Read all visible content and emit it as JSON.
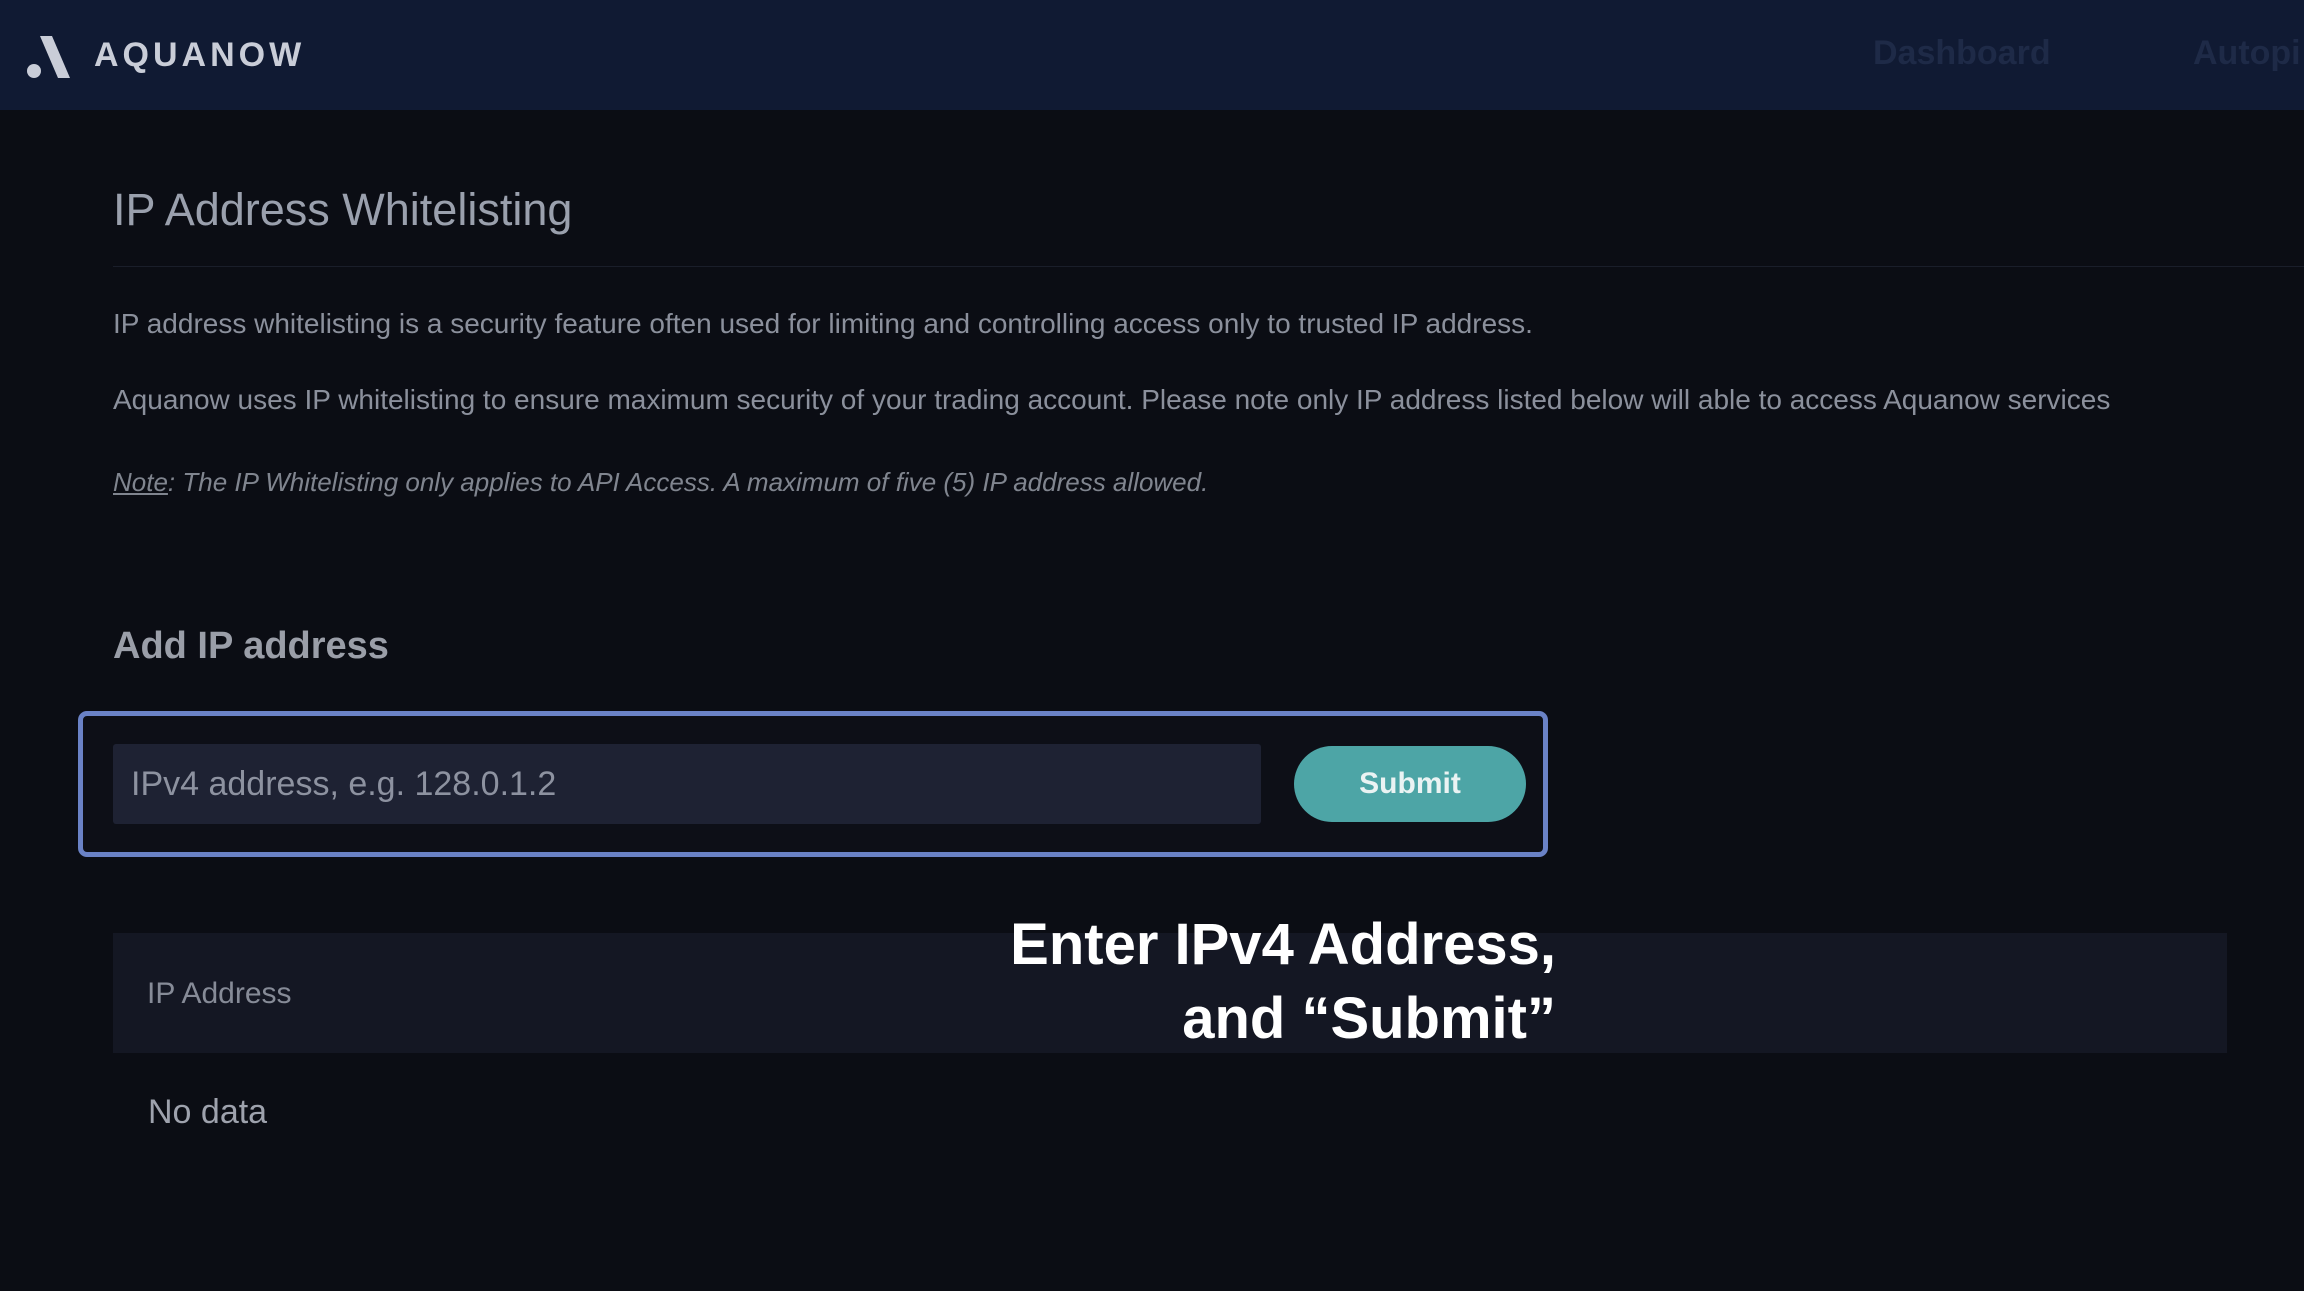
{
  "header": {
    "brand": "AQUANOW",
    "nav": [
      {
        "label": "Dashboard"
      },
      {
        "label": "Autopi"
      }
    ]
  },
  "page": {
    "title": "IP Address Whitelisting",
    "description_1": "IP address whitelisting is a security feature often used for limiting and controlling access only to trusted IP address.",
    "description_2": "Aquanow uses IP whitelisting to ensure maximum security of your trading account. Please note only IP address listed below will able to access Aquanow services",
    "note_label": "Note",
    "note_text": ": The IP Whitelisting only applies to API Access. A maximum of five (5) IP address allowed."
  },
  "add_ip": {
    "section_title": "Add IP address",
    "input_placeholder": "IPv4 address, e.g. 128.0.1.2",
    "input_value": "",
    "submit_label": "Submit"
  },
  "table": {
    "columns": [
      "IP Address"
    ],
    "empty_text": "No data"
  },
  "tutorial_caption": {
    "line_1": "Enter IPv4 Address,",
    "line_2": "and “Submit”"
  },
  "colors": {
    "topbar": "#101a33",
    "background": "#0b0d14",
    "highlight_border": "#6a82c6",
    "submit_button": "#4da5a6"
  }
}
